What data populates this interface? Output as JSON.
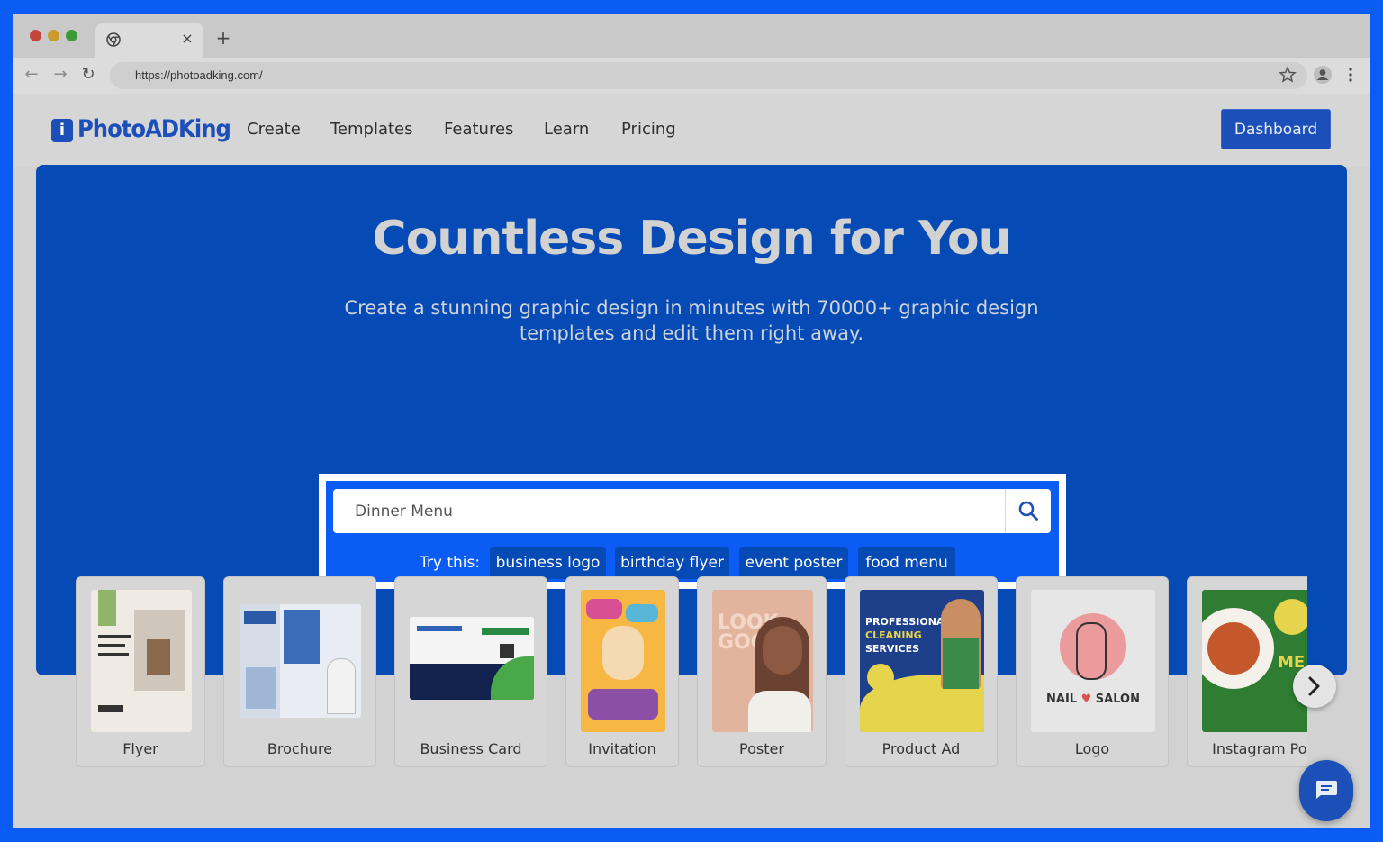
{
  "browser": {
    "url": "https://photoadking.com/",
    "tab_close": "×",
    "new_tab": "+"
  },
  "site": {
    "logo_mark": "i",
    "logo_text": "PhotoADKing",
    "nav": [
      "Create",
      "Templates",
      "Features",
      "Learn",
      "Pricing"
    ],
    "dashboard_label": "Dashboard"
  },
  "hero": {
    "title": "Countless Design for You",
    "subtitle": "Create a stunning graphic design in minutes with 70000+ graphic design templates and edit them right away."
  },
  "search": {
    "value": "Dinner Menu",
    "try_label": "Try this:",
    "suggestions": [
      "business logo",
      "birthday flyer",
      "event poster",
      "food menu"
    ]
  },
  "categories": [
    "Flyer",
    "Brochure",
    "Business Card",
    "Invitation",
    "Poster",
    "Product Ad",
    "Logo",
    "Instagram Pos"
  ],
  "colors": {
    "outer_frame": "#0a5cf5",
    "hero_bg": "#054ab5",
    "brand": "#1d4fb8",
    "search_highlight": "#ffffff"
  },
  "icons": {
    "search": "search-icon",
    "next": "chevron-right-icon",
    "chat": "chat-icon",
    "star": "star-icon",
    "profile": "profile-icon",
    "menu": "more-vertical-icon"
  }
}
